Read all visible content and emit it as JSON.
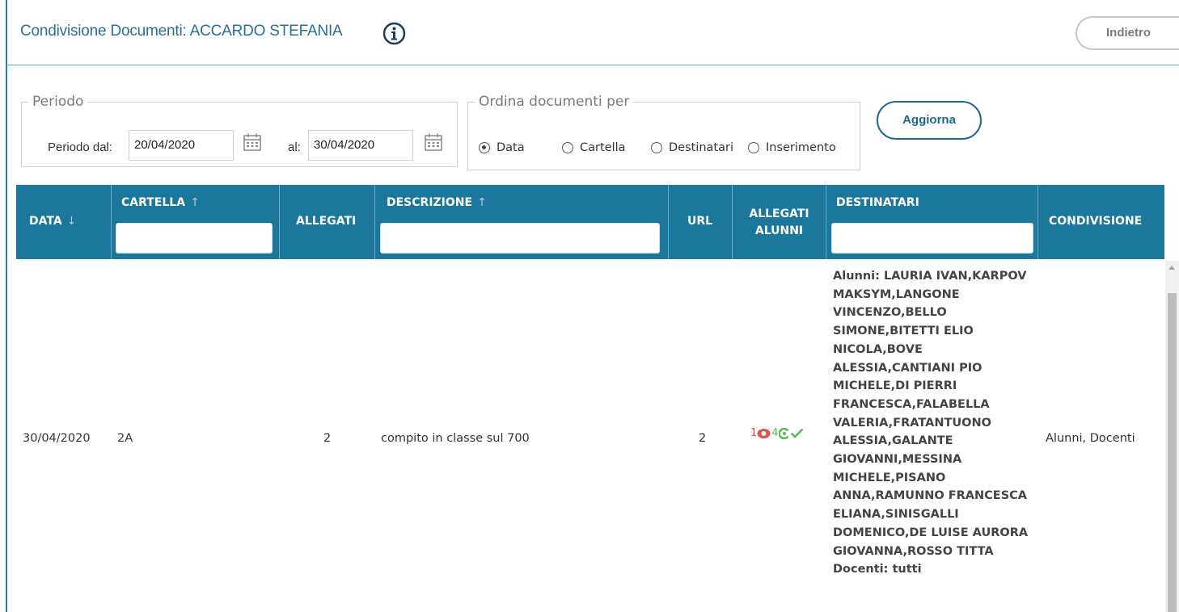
{
  "header": {
    "title": "Condivisione Documenti: ACCARDO STEFANIA",
    "back_label": "Indietro"
  },
  "periodo": {
    "legend": "Periodo",
    "from_label": "Periodo dal:",
    "from_value": "20/04/2020",
    "to_label": "al:",
    "to_value": "30/04/2020"
  },
  "ordina": {
    "legend": "Ordina documenti per",
    "options": [
      {
        "label": "Data",
        "selected": true
      },
      {
        "label": "Cartella",
        "selected": false
      },
      {
        "label": "Destinatari",
        "selected": false
      },
      {
        "label": "Inserimento",
        "selected": false
      }
    ]
  },
  "update_label": "Aggiorna",
  "table": {
    "columns": {
      "data": "DATA",
      "cartella": "CARTELLA",
      "allegati": "ALLEGATI",
      "descrizione": "DESCRIZIONE",
      "url": "URL",
      "allegati_alunni_1": "ALLEGATI",
      "allegati_alunni_2": "ALUNNI",
      "destinatari": "DESTINATARI",
      "condivisione": "CONDIVISIONE"
    },
    "sort_arrows": {
      "data": "↓",
      "cartella": "↑",
      "descrizione": "↑"
    },
    "row": {
      "data": "30/04/2020",
      "cartella": "2A",
      "allegati": "2",
      "descrizione": "compito in classe sul 700",
      "url": "2",
      "allegati_alunni_seen": "1",
      "allegati_alunni_count": "4",
      "destinatari_lines": [
        "Alunni: LAURIA IVAN,KARPOV",
        "MAKSYM,LANGONE",
        "VINCENZO,BELLO",
        "SIMONE,BITETTI ELIO",
        "NICOLA,BOVE",
        "ALESSIA,CANTIANI PIO",
        "MICHELE,DI PIERRI",
        "FRANCESCA,FALABELLA",
        "VALERIA,FRATANTUONO",
        "ALESSIA,GALANTE",
        "GIOVANNI,MESSINA",
        "MICHELE,PISANO",
        "ANNA,RAMUNNO FRANCESCA",
        "ELIANA,SINISGALLI",
        "DOMENICO,DE LUISE AURORA",
        "GIOVANNA,ROSSO TITTA",
        "Docenti: tutti"
      ],
      "condivisione": "Alunni, Docenti"
    }
  },
  "icons": {
    "info": "info-circle-icon",
    "calendar": "calendar-icon",
    "eye": "eye-icon",
    "check": "check-icon"
  },
  "colors": {
    "header_bg": "#1c779c",
    "title": "#2a6f95",
    "eye_red": "#d9534f",
    "check_green": "#5cb85c"
  }
}
